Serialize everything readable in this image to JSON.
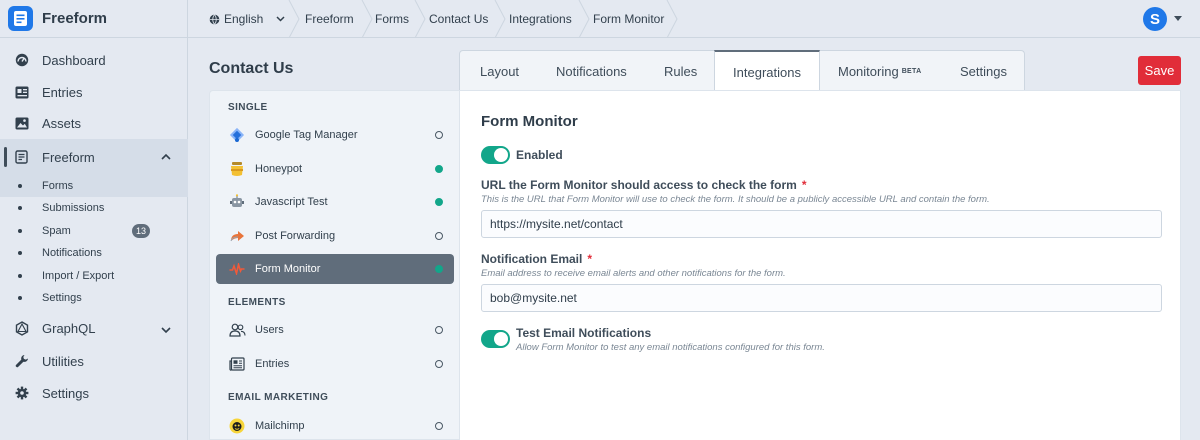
{
  "app": {
    "name": "Freeform"
  },
  "nav": [
    {
      "label": "Dashboard",
      "icon": "dashboard-icon"
    },
    {
      "label": "Entries",
      "icon": "entries-icon"
    },
    {
      "label": "Assets",
      "icon": "assets-icon"
    },
    {
      "label": "Freeform",
      "icon": "freeform-icon"
    },
    {
      "label": "GraphQL",
      "icon": "graphql-icon"
    },
    {
      "label": "Utilities",
      "icon": "utilities-icon"
    },
    {
      "label": "Settings",
      "icon": "settings-icon"
    }
  ],
  "freeform_sub": [
    {
      "label": "Forms"
    },
    {
      "label": "Submissions"
    },
    {
      "label": "Spam",
      "badge": "13"
    },
    {
      "label": "Notifications"
    },
    {
      "label": "Import / Export"
    },
    {
      "label": "Settings"
    }
  ],
  "topbar": {
    "language": "English",
    "breadcrumbs": [
      "Freeform",
      "Forms",
      "Contact Us",
      "Integrations",
      "Form Monitor"
    ],
    "user_initial": "S"
  },
  "page": {
    "title": "Contact Us",
    "save_label": "Save"
  },
  "tabs": [
    {
      "label": "Layout"
    },
    {
      "label": "Notifications"
    },
    {
      "label": "Rules"
    },
    {
      "label": "Integrations"
    },
    {
      "label": "Monitoring",
      "badge": "BETA"
    },
    {
      "label": "Settings"
    }
  ],
  "integrations": {
    "sections": [
      {
        "title": "SINGLE"
      },
      {
        "title": "ELEMENTS"
      },
      {
        "title": "EMAIL MARKETING"
      }
    ],
    "items": [
      {
        "label": "Google Tag Manager",
        "enabled": false
      },
      {
        "label": "Honeypot",
        "enabled": true
      },
      {
        "label": "Javascript Test",
        "enabled": true
      },
      {
        "label": "Post Forwarding",
        "enabled": false
      },
      {
        "label": "Form Monitor",
        "enabled": true
      },
      {
        "label": "Users",
        "enabled": false
      },
      {
        "label": "Entries",
        "enabled": false
      },
      {
        "label": "Mailchimp",
        "enabled": false
      }
    ]
  },
  "form_monitor": {
    "title": "Form Monitor",
    "enabled_label": "Enabled",
    "enabled": true,
    "url_label": "URL the Form Monitor should access to check the form",
    "url_help": "This is the URL that Form Monitor will use to check the form. It should be a publicly accessible URL and contain the form.",
    "url_value": "https://mysite.net/contact",
    "email_label": "Notification Email",
    "email_help": "Email address to receive email alerts and other notifications for the form.",
    "email_value": "bob@mysite.net",
    "test_label": "Test Email Notifications",
    "test_help": "Allow Form Monitor to test any email notifications configured for this form.",
    "test_enabled": true,
    "required_mark": "*"
  },
  "colors": {
    "accent": "#12a68a",
    "save": "#e12d39",
    "brand": "#1f78e8"
  }
}
